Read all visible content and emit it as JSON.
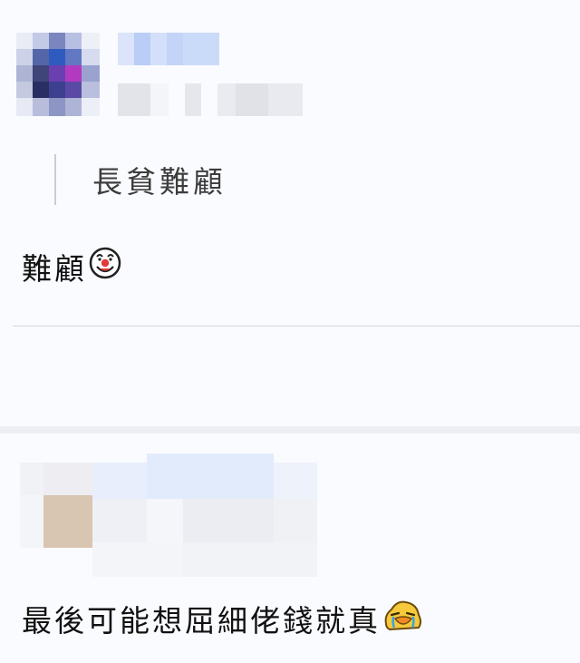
{
  "comments": [
    {
      "quote": "長貧難顧",
      "body": "難顧",
      "emoji": "clown-face-icon"
    },
    {
      "body": "最後可能想屈細佬錢就真",
      "emoji": "crying-duck-icon"
    }
  ],
  "colors": {
    "background": "#f7f8fc",
    "divider": "#d3d6de",
    "quote_bar": "#c9ccd6",
    "text": "#111111"
  }
}
